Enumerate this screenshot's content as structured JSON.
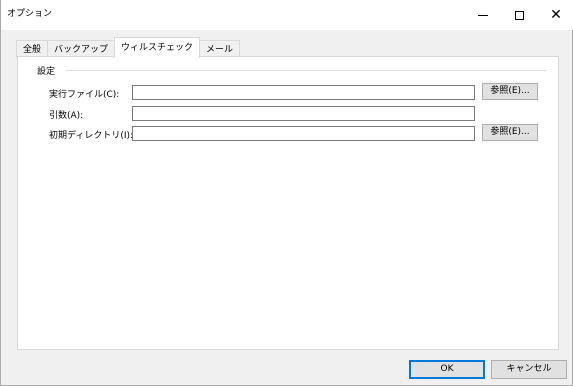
{
  "window": {
    "title": "オプション"
  },
  "tabs": [
    {
      "label": "全般",
      "active": false
    },
    {
      "label": "バックアップ",
      "active": false
    },
    {
      "label": "ウィルスチェック",
      "active": true
    },
    {
      "label": "メール",
      "active": false
    }
  ],
  "settings_group": {
    "label": "設定",
    "executable": {
      "label": "実行ファイル(C):",
      "value": "",
      "browse_label": "参照(E)..."
    },
    "arguments": {
      "label": "引数(A):",
      "value": ""
    },
    "initial_directory": {
      "label": "初期ディレクトリ(I):",
      "value": "",
      "browse_label": "参照(E)..."
    }
  },
  "buttons": {
    "ok": "OK",
    "cancel": "キャンセル"
  },
  "colors": {
    "dialog_background": "#f0f0f0",
    "panel_background": "#ffffff",
    "default_button_border": "#0078d7"
  }
}
